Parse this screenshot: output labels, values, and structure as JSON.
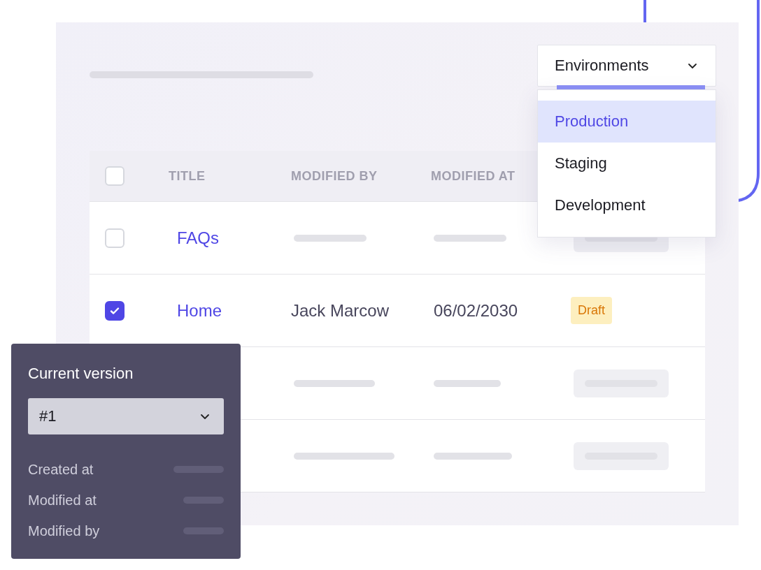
{
  "environment_dropdown": {
    "label": "Environments",
    "expanded": true,
    "options": [
      {
        "label": "Production",
        "selected": true
      },
      {
        "label": "Staging",
        "selected": false
      },
      {
        "label": "Development",
        "selected": false
      }
    ]
  },
  "table": {
    "select_all_checked": false,
    "columns": [
      "TITLE",
      "MODIFIED BY",
      "MODIFIED AT"
    ],
    "rows": [
      {
        "kind": "partial",
        "checked": false,
        "title": "FAQs"
      },
      {
        "kind": "full",
        "checked": true,
        "title": "Home",
        "modified_by": "Jack Marcow",
        "modified_at": "06/02/2030",
        "status": "Draft"
      },
      {
        "kind": "skeleton"
      },
      {
        "kind": "skeleton"
      }
    ]
  },
  "version_panel": {
    "title": "Current version",
    "version": "#1",
    "fields": [
      "Created at",
      "Modified at",
      "Modified by"
    ]
  }
}
